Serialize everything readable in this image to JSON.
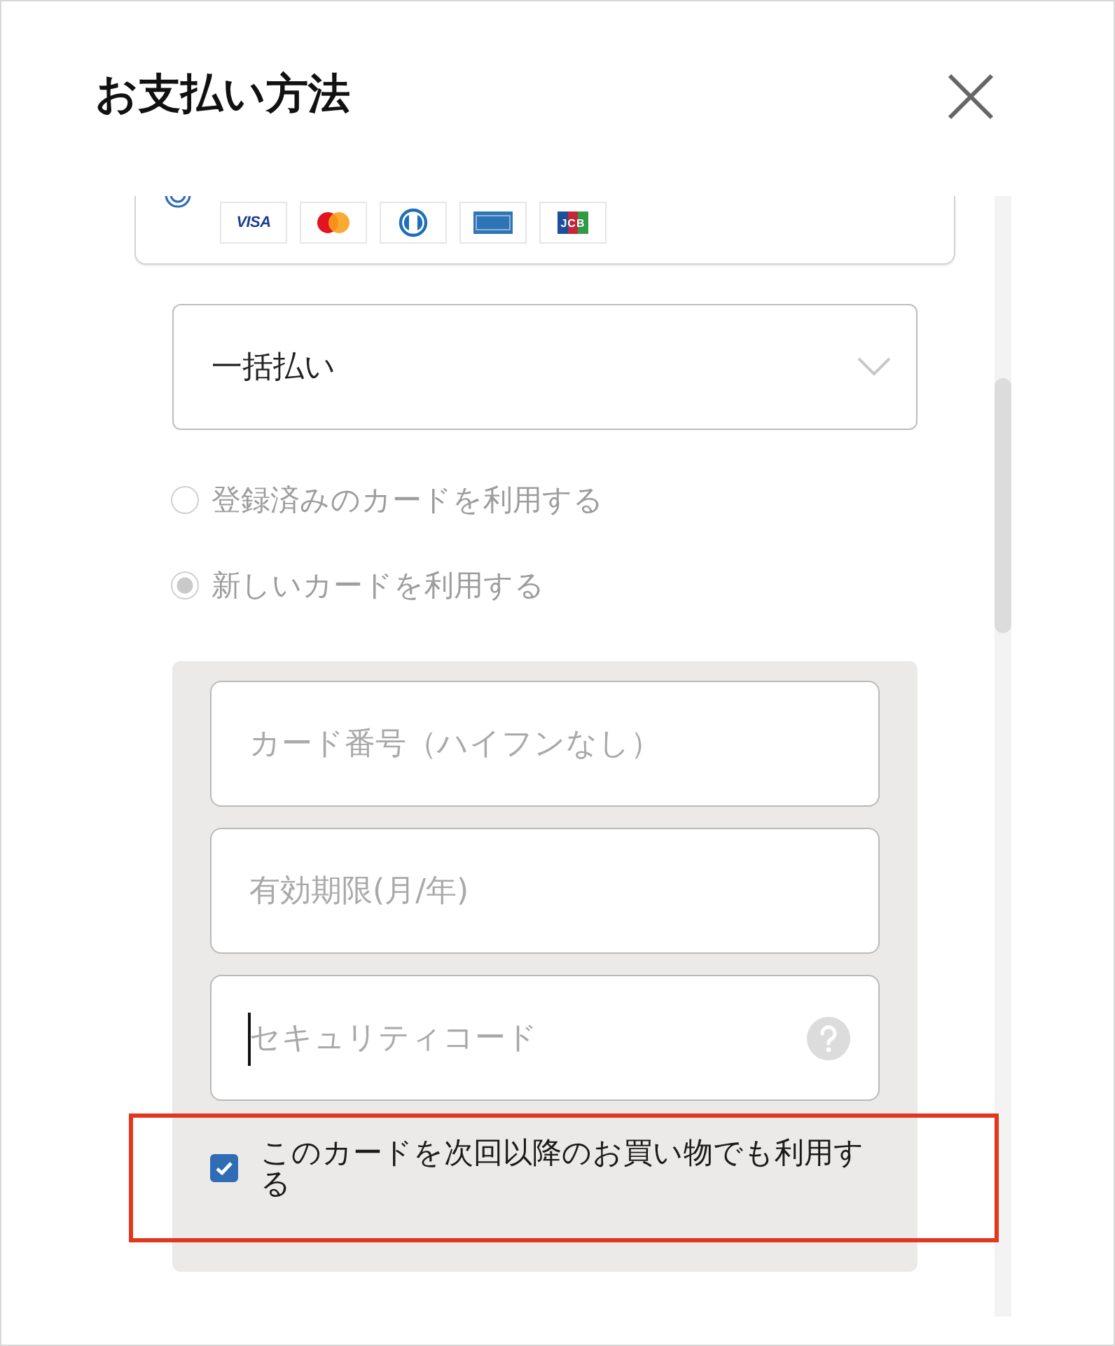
{
  "dialog": {
    "title": "お支払い方法"
  },
  "payment_method": {
    "selected": true,
    "card_brands": [
      {
        "kind": "visa",
        "label": "VISA"
      },
      {
        "kind": "mastercard"
      },
      {
        "kind": "diners"
      },
      {
        "kind": "amex"
      },
      {
        "kind": "jcb",
        "label": "JCB"
      }
    ]
  },
  "installment_select": {
    "value": "一括払い"
  },
  "card_choice": [
    {
      "label": "登録済みのカードを利用する",
      "selected": false,
      "disabled": true
    },
    {
      "label": "新しいカードを利用する",
      "selected": true,
      "disabled": true
    }
  ],
  "card_fields": [
    {
      "placeholder": "カード番号（ハイフンなし）",
      "focused": false,
      "help": false
    },
    {
      "placeholder": "有効期限(月/年)",
      "focused": false,
      "help": false
    },
    {
      "placeholder": "セキュリティコード",
      "focused": true,
      "help": true
    }
  ],
  "save_card": {
    "label": "このカードを次回以降のお買い物でも利用する",
    "checked": true,
    "highlighted": true
  }
}
